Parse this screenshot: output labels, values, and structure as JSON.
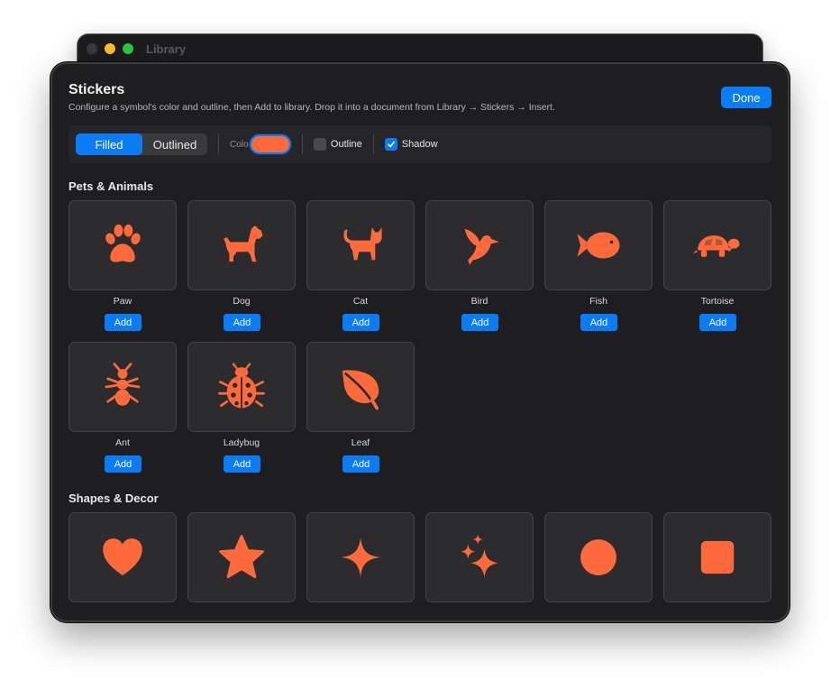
{
  "background_window": {
    "title": "Library"
  },
  "sheet": {
    "title": "Stickers",
    "subtitle": "Configure a symbol's color and outline, then Add to library. Drop it into a document from Library → Stickers → Insert.",
    "done_label": "Done"
  },
  "toolbar": {
    "style_options": [
      "Filled",
      "Outlined"
    ],
    "selected_style": "Filled",
    "color_label": "Color",
    "color_value": "#ff6a3d",
    "outline_label": "Outline",
    "outline_checked": false,
    "shadow_label": "Shadow",
    "shadow_checked": true
  },
  "colors": {
    "accent": "#0a7cf5",
    "sticker": "#ff6a3d",
    "tile_bg": "#2c2c2e"
  },
  "sections": [
    {
      "title": "Pets & Animals",
      "items": [
        {
          "label": "Paw",
          "icon": "paw-icon",
          "add_label": "Add"
        },
        {
          "label": "Dog",
          "icon": "dog-icon",
          "add_label": "Add"
        },
        {
          "label": "Cat",
          "icon": "cat-icon",
          "add_label": "Add"
        },
        {
          "label": "Bird",
          "icon": "bird-icon",
          "add_label": "Add"
        },
        {
          "label": "Fish",
          "icon": "fish-icon",
          "add_label": "Add"
        },
        {
          "label": "Tortoise",
          "icon": "tortoise-icon",
          "add_label": "Add"
        },
        {
          "label": "Ant",
          "icon": "ant-icon",
          "add_label": "Add"
        },
        {
          "label": "Ladybug",
          "icon": "ladybug-icon",
          "add_label": "Add"
        },
        {
          "label": "Leaf",
          "icon": "leaf-icon",
          "add_label": "Add"
        }
      ]
    },
    {
      "title": "Shapes & Decor",
      "items": [
        {
          "icon": "heart-icon"
        },
        {
          "icon": "star-icon"
        },
        {
          "icon": "sparkle-icon"
        },
        {
          "icon": "sparkles-icon"
        },
        {
          "icon": "circle-icon"
        },
        {
          "icon": "square-icon"
        }
      ]
    }
  ]
}
